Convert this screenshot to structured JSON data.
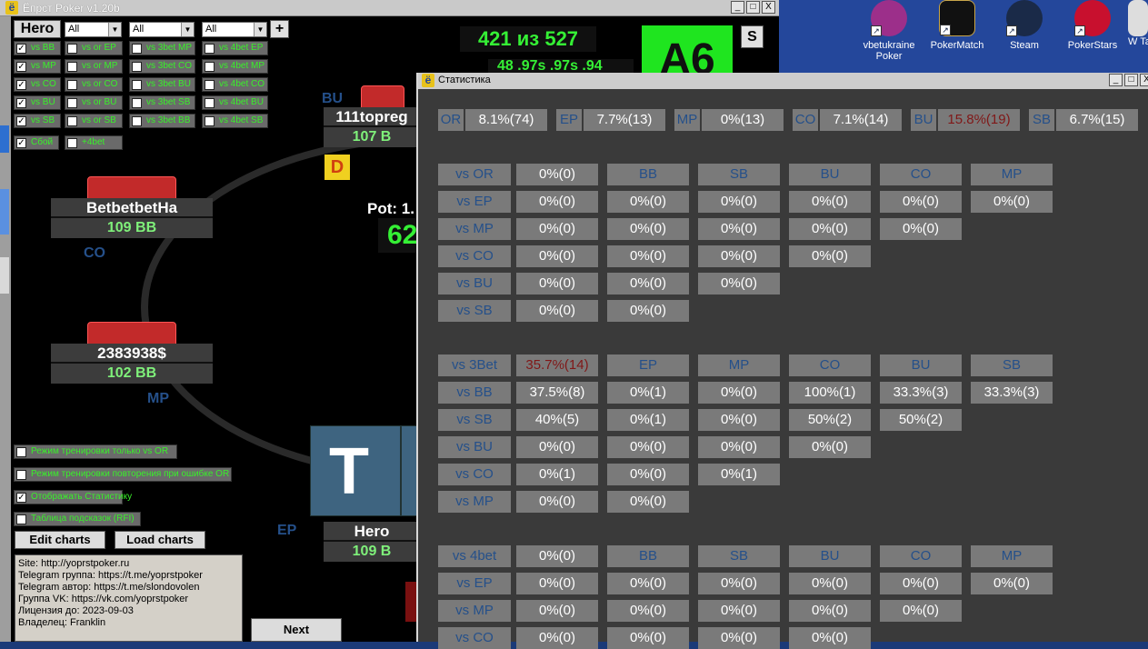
{
  "poker_window": {
    "title": "Ёпрст Poker v1.20b",
    "title_btns": [
      "_",
      "□",
      "X"
    ]
  },
  "desktop": {
    "icons": [
      {
        "name": "vbetukraine Poker"
      },
      {
        "name": "PokerMatch"
      },
      {
        "name": "Steam"
      },
      {
        "name": "PokerStars"
      },
      {
        "name": "W Ta"
      }
    ]
  },
  "filters": {
    "hero_label": "Hero",
    "selects": [
      "All",
      "All",
      "All"
    ],
    "plus": "+",
    "col1": [
      "vs BB",
      "vs MP",
      "vs CO",
      "vs BU",
      "vs SB"
    ],
    "col2": [
      "vs or EP",
      "vs or MP",
      "vs or CO",
      "vs or BU",
      "vs or SB"
    ],
    "col3": [
      "vs 3bet MP",
      "vs 3bet CO",
      "vs 3bet BU",
      "vs 3bet SB",
      "vs 3bet BB"
    ],
    "col4": [
      "vs 4bet EP",
      "vs 4bet MP",
      "vs 4bet CO",
      "vs 4bet BU",
      "vs 4bet SB"
    ],
    "extra": [
      "Сбой",
      "+4bet"
    ]
  },
  "counter": {
    "text": "421 из 527",
    "partial": "48 .97s .97s .94",
    "card": "A6",
    "s_btn": "S"
  },
  "table": {
    "seats": [
      {
        "name": "111topreg",
        "stack": "107 B",
        "pos": "BU"
      },
      {
        "name": "BetbetbetHa",
        "stack": "109 BB",
        "pos": "CO"
      },
      {
        "name": "2383938$",
        "stack": "102 BB",
        "pos": "MP"
      },
      {
        "name": "Hero",
        "stack": "109 B",
        "pos": "EP"
      }
    ],
    "dealer": "D",
    "pot": "Pot: 1.",
    "pot_num": "62",
    "big_card": "T"
  },
  "options": [
    "Режим тренировки только vs OR",
    "Режим тренировки повторения при ошибке OR",
    "Отображать Статистику",
    "Таблица подсказок (RFI)"
  ],
  "buttons": {
    "edit": "Edit charts",
    "load": "Load charts",
    "next": "Next"
  },
  "info": [
    "Site: http://yoprstpoker.ru",
    "Telegram группа: https://t.me/yoprstpoker",
    "Telegram автор: https://t.me/slondovolen",
    "Группа VK: https://vk.com/yoprstpoker",
    "Лицензия до: 2023-09-03",
    "Владелец: Franklin"
  ],
  "stats_window": {
    "title": "Статистика",
    "top": [
      {
        "label": "OR",
        "value": "8.1%(74)"
      },
      {
        "label": "EP",
        "value": "7.7%(13)"
      },
      {
        "label": "MP",
        "value": "0%(13)"
      },
      {
        "label": "CO",
        "value": "7.1%(14)"
      },
      {
        "label": "BU",
        "value": "15.8%(19)"
      },
      {
        "label": "SB",
        "value": "6.7%(15)"
      }
    ],
    "s1": {
      "head": [
        "vs OR",
        "0%(0)",
        "BB",
        "SB",
        "BU",
        "CO",
        "MP"
      ],
      "rows": [
        [
          "vs EP",
          "0%(0)",
          "0%(0)",
          "0%(0)",
          "0%(0)",
          "0%(0)",
          "0%(0)"
        ],
        [
          "vs MP",
          "0%(0)",
          "0%(0)",
          "0%(0)",
          "0%(0)",
          "0%(0)"
        ],
        [
          "vs CO",
          "0%(0)",
          "0%(0)",
          "0%(0)",
          "0%(0)"
        ],
        [
          "vs BU",
          "0%(0)",
          "0%(0)",
          "0%(0)"
        ],
        [
          "vs SB",
          "0%(0)",
          "0%(0)"
        ]
      ]
    },
    "s2": {
      "head": [
        "vs 3Bet",
        "35.7%(14)",
        "EP",
        "MP",
        "CO",
        "BU",
        "SB"
      ],
      "rows": [
        [
          "vs BB",
          "37.5%(8)",
          "0%(1)",
          "0%(0)",
          "100%(1)",
          "33.3%(3)",
          "33.3%(3)"
        ],
        [
          "vs SB",
          "40%(5)",
          "0%(1)",
          "0%(0)",
          "50%(2)",
          "50%(2)"
        ],
        [
          "vs BU",
          "0%(0)",
          "0%(0)",
          "0%(0)",
          "0%(0)"
        ],
        [
          "vs CO",
          "0%(1)",
          "0%(0)",
          "0%(1)"
        ],
        [
          "vs MP",
          "0%(0)",
          "0%(0)"
        ]
      ]
    },
    "s3": {
      "head": [
        "vs 4bet",
        "0%(0)",
        "BB",
        "SB",
        "BU",
        "CO",
        "MP"
      ],
      "rows": [
        [
          "vs EP",
          "0%(0)",
          "0%(0)",
          "0%(0)",
          "0%(0)",
          "0%(0)",
          "0%(0)"
        ],
        [
          "vs MP",
          "0%(0)",
          "0%(0)",
          "0%(0)",
          "0%(0)",
          "0%(0)"
        ],
        [
          "vs CO",
          "0%(0)",
          "0%(0)",
          "0%(0)",
          "0%(0)"
        ]
      ]
    }
  }
}
